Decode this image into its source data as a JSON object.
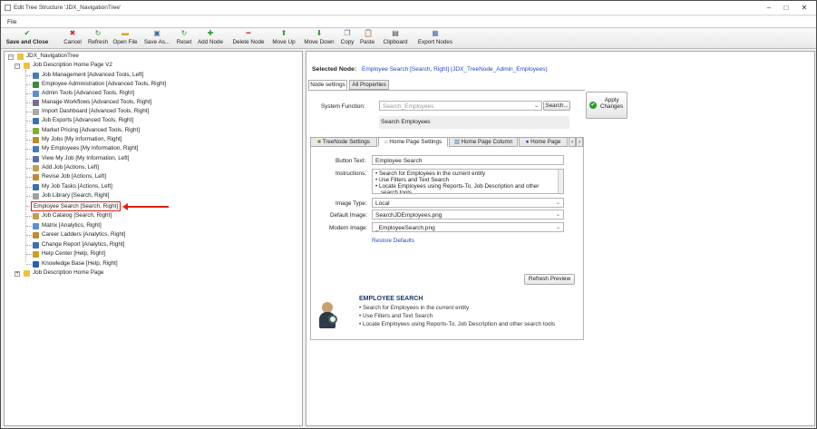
{
  "window": {
    "title": "Edit Tree Structure 'JDX_NavigationTree'"
  },
  "menu": {
    "file": "File"
  },
  "toolbar": [
    {
      "label": "Save and Close",
      "icon": "save-close-icon",
      "color": "#2a9a2a",
      "glyph": "✔"
    },
    {
      "label": "Cancel",
      "icon": "cancel-icon",
      "color": "#d22",
      "glyph": "✖"
    },
    {
      "label": "Refresh",
      "icon": "refresh-icon",
      "color": "#2a9a2a",
      "glyph": "↻"
    },
    {
      "label": "Open File",
      "icon": "folder-icon",
      "color": "#d9a520",
      "glyph": "▬"
    },
    {
      "label": "Save As...",
      "icon": "floppy-icon",
      "color": "#4a6fa5",
      "glyph": "▣"
    },
    {
      "label": "Reset",
      "icon": "reset-icon",
      "color": "#2a9a2a",
      "glyph": "↻"
    },
    {
      "label": "Add Node",
      "icon": "plus-icon",
      "color": "#2a9a2a",
      "glyph": "✚"
    },
    {
      "label": "Delete Node",
      "icon": "minus-icon",
      "color": "#d22",
      "glyph": "━"
    },
    {
      "label": "Move Up",
      "icon": "arrow-up-icon",
      "color": "#2a9a2a",
      "glyph": "⬆"
    },
    {
      "label": "Move Down",
      "icon": "arrow-down-icon",
      "color": "#2a9a2a",
      "glyph": "⬇"
    },
    {
      "label": "Copy",
      "icon": "copy-icon",
      "color": "#4a6fa5",
      "glyph": "❐"
    },
    {
      "label": "Paste",
      "icon": "paste-icon",
      "color": "#c08a30",
      "glyph": "📋"
    },
    {
      "label": "Clipboard",
      "icon": "clipboard-icon",
      "color": "#444",
      "glyph": "▤"
    },
    {
      "label": "Export Nodes",
      "icon": "export-icon",
      "color": "#4a6fa5",
      "glyph": "▦"
    }
  ],
  "tree": {
    "root": "JDX_NavigationTree",
    "group1": "Job Description Home Page V2",
    "items": [
      {
        "label": "Job Management [Advanced Tools, Left]",
        "color": "#4a7ab8"
      },
      {
        "label": "Employee Administration [Advanced Tools, Right]",
        "color": "#3b8a3b"
      },
      {
        "label": "Admin Tools [Advanced Tools, Right]",
        "color": "#5a8fd0"
      },
      {
        "label": "Manage Workflows [Advanced Tools, Right]",
        "color": "#7a6a9a"
      },
      {
        "label": "Import Dashboard [Advanced Tools, Right]",
        "color": "#a8a8a8"
      },
      {
        "label": "Job Exports [Advanced Tools, Right]",
        "color": "#3b6fb0"
      },
      {
        "label": "Market Pricing [Advanced Tools, Right]",
        "color": "#7ab030"
      },
      {
        "label": "My Jobs [My Information, Right]",
        "color": "#c08a30"
      },
      {
        "label": "My Employees [My Information, Right]",
        "color": "#4a7ab8"
      },
      {
        "label": "View My Job [My Information, Left]",
        "color": "#5a6fa0"
      },
      {
        "label": "Add Job [Actions, Left]",
        "color": "#c0a050"
      },
      {
        "label": "Revise Job [Actions, Left]",
        "color": "#c08a30"
      },
      {
        "label": "My Job Tasks [Actions, Left]",
        "color": "#3b6fb0"
      },
      {
        "label": "Job Library [Search, Right]",
        "color": "#a0a0a0"
      },
      {
        "label": "Employee Search [Search, Right]",
        "color": "#ffffff"
      },
      {
        "label": "Job Catalog [Search, Right]",
        "color": "#c0a050"
      },
      {
        "label": "Matrix [Analytics, Right]",
        "color": "#5a8fd0"
      },
      {
        "label": "Career Ladders [Analytics, Right]",
        "color": "#c08a30"
      },
      {
        "label": "Change Report [Analytics, Right]",
        "color": "#3b6fb0"
      },
      {
        "label": "Help Center [Help, Right]",
        "color": "#c9a020"
      },
      {
        "label": "Knowledge Base [Help, Right]",
        "color": "#2a5fb0"
      }
    ],
    "group2": "Job Description Home Page"
  },
  "details": {
    "selected_label": "Selected Node:",
    "selected_value": "Employee Search [Search, Right] (JDX_TreeNode_Admin_Employees)",
    "tabs": [
      "Node settings",
      "All Properties"
    ],
    "apply_btn": "Apply\nChanges",
    "system_function_label": "System Function:",
    "system_function_placeholder": "Search_Employees",
    "search_btn": "Search...",
    "system_function_desc": "Search Employees",
    "inner_tabs": [
      "TreeNode Settings",
      "Home Page Settings",
      "Home Page Column",
      "Home Page"
    ],
    "button_text_label": "Button Text:",
    "button_text_value": "Employee Search",
    "instructions_label": "Instructions:",
    "instructions": [
      "• Search for Employees in the current entity",
      "• Use Filters and Text Search",
      "• Locate Employees using Reports-To, Job Description and other",
      "search tools"
    ],
    "image_type_label": "Image Type:",
    "image_type_value": "Local",
    "default_image_label": "Default Image:",
    "default_image_value": "SearchJDEmployees.png",
    "modern_image_label": "Modern Image:",
    "modern_image_value": "_EmployeeSearch.png",
    "restore": "Restore Defaults",
    "refresh_preview": "Refresh Preview",
    "preview_title": "EMPLOYEE SEARCH",
    "preview_bullets": [
      "• Search for Employees in the current entity",
      "• Use Filters and Text Search",
      "• Locate Employees using Reports-To, Job Description and other search tools"
    ]
  }
}
